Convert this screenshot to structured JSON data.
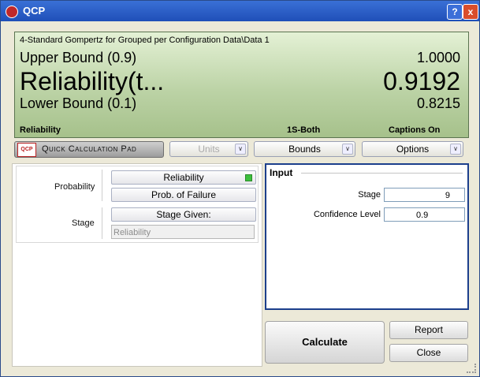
{
  "window": {
    "title": "QCP",
    "help_label": "?",
    "close_label": "x"
  },
  "display": {
    "caption": "4-Standard Gompertz for Grouped per Configuration Data\\Data 1",
    "upper_label": "Upper Bound (0.9)",
    "upper_value": "1.0000",
    "main_label": "Reliability(t...",
    "main_value": "0.9192",
    "lower_label": "Lower Bound (0.1)",
    "lower_value": "0.8215",
    "status_metric": "Reliability",
    "status_sides": "1S-Both",
    "status_captions": "Captions On"
  },
  "toolbar": {
    "logo_text": "QCP",
    "pad_label": "Quick Calculation Pad",
    "units_label": "Units",
    "bounds_label": "Bounds",
    "options_label": "Options",
    "arrow_glyph": "∨"
  },
  "left": {
    "probability_label": "Probability",
    "reliability_button": "Reliability",
    "prob_failure_button": "Prob. of Failure",
    "stage_label": "Stage",
    "stage_given_button": "Stage Given:",
    "stage_field_value": "Reliability"
  },
  "input": {
    "header": "Input",
    "stage_label": "Stage",
    "stage_value": "9",
    "confidence_label": "Confidence Level",
    "confidence_value": "0.9"
  },
  "buttons": {
    "calculate": "Calculate",
    "report": "Report",
    "close": "Close"
  }
}
